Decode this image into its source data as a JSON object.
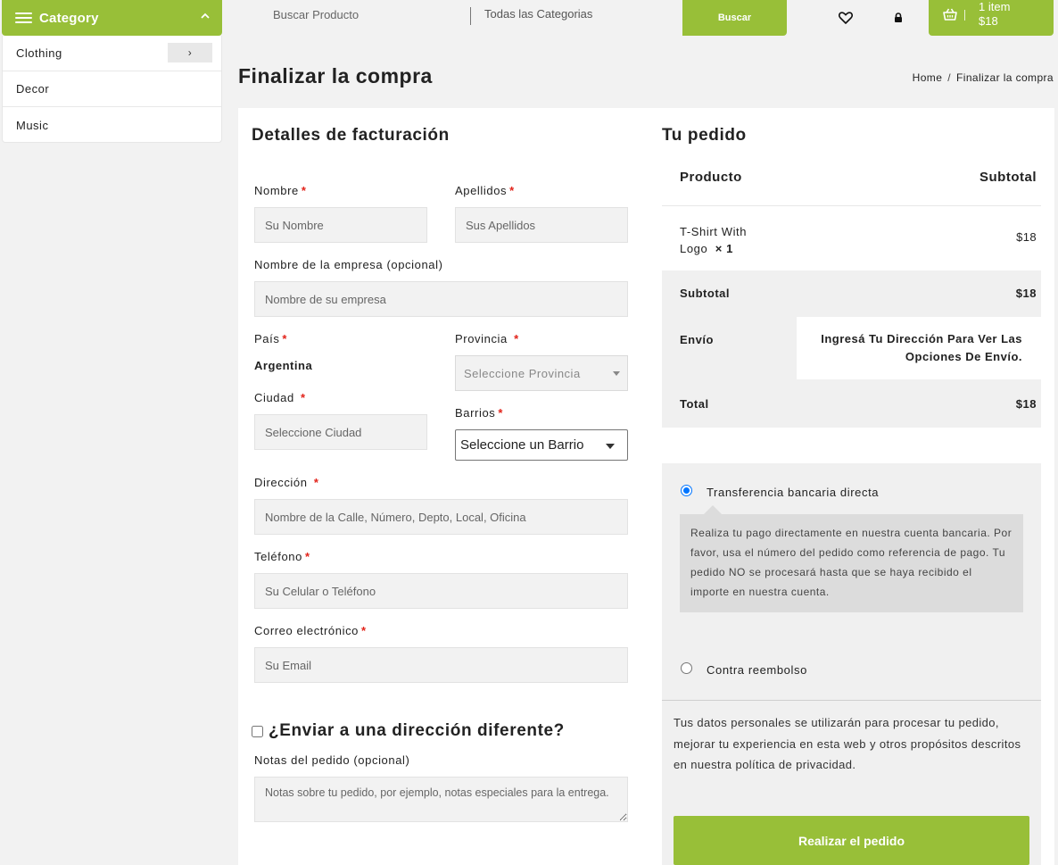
{
  "category": {
    "header_label": "Category",
    "items": [
      {
        "label": "Clothing",
        "arrow": "›"
      },
      {
        "label": "Decor"
      },
      {
        "label": "Music"
      }
    ]
  },
  "search": {
    "placeholder": "Buscar Producto",
    "category_label": "Todas las Categorias",
    "button_label": "Buscar"
  },
  "cart": {
    "count_label": "1 item",
    "amount": "$18"
  },
  "page": {
    "title": "Finalizar la compra",
    "breadcrumb": {
      "home": "Home",
      "separator": "/",
      "current": "Finalizar la compra"
    }
  },
  "billing": {
    "title": "Detalles de facturación",
    "required_mark": "*",
    "first_name": {
      "label": "Nombre",
      "placeholder": "Su Nombre"
    },
    "last_name": {
      "label": "Apellidos",
      "placeholder": "Sus Apellidos"
    },
    "company": {
      "label": "Nombre de la empresa (opcional)",
      "placeholder": "Nombre de su empresa"
    },
    "country": {
      "label": "País",
      "value": "Argentina"
    },
    "province": {
      "label": "Provincia",
      "placeholder": "Seleccione Provincia"
    },
    "city": {
      "label": "Ciudad",
      "placeholder": "Seleccione Ciudad"
    },
    "barrio": {
      "label": "Barrios",
      "value": "Seleccione un Barrio"
    },
    "address": {
      "label": "Dirección",
      "placeholder": "Nombre de la Calle, Número, Depto, Local, Oficina"
    },
    "phone": {
      "label": "Teléfono",
      "placeholder": "Su Celular o Teléfono"
    },
    "email": {
      "label": "Correo electrónico",
      "placeholder": "Su Email"
    },
    "ship_different": "¿Enviar a una dirección diferente?",
    "notes": {
      "label": "Notas del pedido (opcional)",
      "placeholder": "Notas sobre tu pedido, por ejemplo, notas especiales para la entrega."
    }
  },
  "order": {
    "title": "Tu pedido",
    "col_product": "Producto",
    "col_subtotal": "Subtotal",
    "item": {
      "name": "T-Shirt With Logo",
      "qty": "× 1",
      "price": "$18"
    },
    "subtotal_label": "Subtotal",
    "subtotal_value": "$18",
    "shipping_label": "Envío",
    "shipping_value": "Ingresá Tu Dirección Para Ver Las Opciones De Envío.",
    "total_label": "Total",
    "total_value": "$18"
  },
  "payment": {
    "methods": [
      {
        "label": "Transferencia bancaria directa",
        "selected": true,
        "description": "Realiza tu pago directamente en nuestra cuenta bancaria. Por favor, usa el número del pedido como referencia de pago. Tu pedido NO se procesará hasta que se haya recibido el importe en nuestra cuenta."
      },
      {
        "label": "Contra reembolso",
        "selected": false
      }
    ],
    "privacy_text": "Tus datos personales se utilizarán para procesar tu pedido, mejorar tu experiencia en esta web y otros propósitos descritos en nuestra política de privacidad.",
    "place_order_label": "Realizar el pedido"
  },
  "colors": {
    "accent": "#98bf38",
    "required": "#e2231a",
    "radio_selected": "#0075ff"
  }
}
